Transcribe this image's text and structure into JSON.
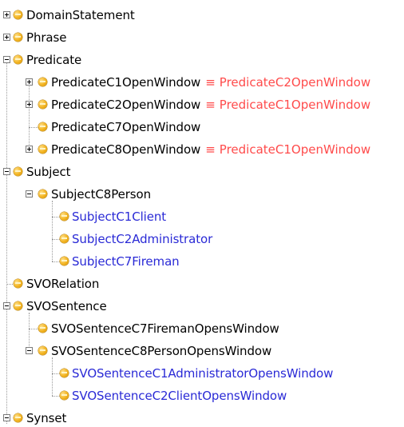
{
  "tree": {
    "nodes": [
      {
        "label": "DomainStatement",
        "expander": "plus",
        "color": "black"
      },
      {
        "label": "Phrase",
        "expander": "plus",
        "color": "black"
      },
      {
        "label": "Predicate",
        "expander": "minus",
        "color": "black"
      },
      {
        "label": "PredicateC1OpenWindow",
        "expander": "plus",
        "color": "black",
        "equivalent": "PredicateC2OpenWindow"
      },
      {
        "label": "PredicateC2OpenWindow",
        "expander": "plus",
        "color": "black",
        "equivalent": "PredicateC1OpenWindow"
      },
      {
        "label": "PredicateC7OpenWindow",
        "expander": "none",
        "color": "black"
      },
      {
        "label": "PredicateC8OpenWindow",
        "expander": "plus",
        "color": "black",
        "equivalent": "PredicateC1OpenWindow"
      },
      {
        "label": "Subject",
        "expander": "minus",
        "color": "black"
      },
      {
        "label": "SubjectC8Person",
        "expander": "minus",
        "color": "black"
      },
      {
        "label": "SubjectC1Client",
        "expander": "none",
        "color": "blue"
      },
      {
        "label": "SubjectC2Administrator",
        "expander": "none",
        "color": "blue"
      },
      {
        "label": "SubjectC7Fireman",
        "expander": "none",
        "color": "blue"
      },
      {
        "label": "SVORelation",
        "expander": "none",
        "color": "black"
      },
      {
        "label": "SVOSentence",
        "expander": "minus",
        "color": "black"
      },
      {
        "label": "SVOSentenceC7FiremanOpensWindow",
        "expander": "none",
        "color": "black"
      },
      {
        "label": "SVOSentenceC8PersonOpensWindow",
        "expander": "minus",
        "color": "black"
      },
      {
        "label": "SVOSentenceC1AdministratorOpensWindow",
        "expander": "none",
        "color": "blue"
      },
      {
        "label": "SVOSentenceC2ClientOpensWindow",
        "expander": "none",
        "color": "blue"
      },
      {
        "label": "Synset",
        "expander": "minus",
        "color": "black"
      }
    ],
    "equivalence_symbol": "≡"
  },
  "colors": {
    "class_icon": "#f2b21d",
    "label_blue": "#2a2ad6",
    "equivalent_red": "#ff4b4b"
  },
  "icons": {
    "class": "class-icon",
    "expand": "expand-icon",
    "collapse": "collapse-icon"
  }
}
